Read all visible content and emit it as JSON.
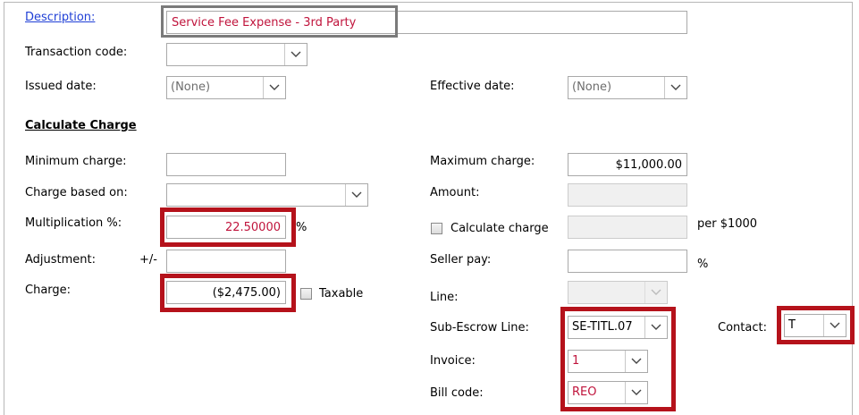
{
  "description": {
    "label": "Description:",
    "value": "Service Fee Expense - 3rd Party"
  },
  "transaction_code": {
    "label": "Transaction code:",
    "value": ""
  },
  "issued_date": {
    "label": "Issued date:",
    "value": "(None)"
  },
  "effective_date": {
    "label": "Effective date:",
    "value": "(None)"
  },
  "calculate_charge": {
    "heading": "Calculate Charge",
    "minimum_charge": {
      "label": "Minimum charge:",
      "value": ""
    },
    "maximum_charge": {
      "label": "Maximum charge:",
      "value": "$11,000.00"
    },
    "charge_based_on": {
      "label": "Charge based on:",
      "value": ""
    },
    "amount": {
      "label": "Amount:",
      "value": ""
    },
    "multiplication": {
      "label": "Multiplication %:",
      "value": "22.50000",
      "suffix": "%"
    },
    "calculate_checkbox": {
      "label": "Calculate charge",
      "checked": false
    },
    "per_1000": {
      "value": "",
      "suffix": "per $1000"
    },
    "adjustment": {
      "label": "Adjustment:",
      "sign": "+/-",
      "value": ""
    },
    "seller_pay": {
      "label": "Seller pay:",
      "value": "",
      "suffix": "%"
    },
    "charge": {
      "label": "Charge:",
      "value": "($2,475.00)"
    },
    "taxable": {
      "label": "Taxable",
      "checked": false
    },
    "line": {
      "label": "Line:",
      "value": ""
    },
    "sub_escrow_line": {
      "label": "Sub-Escrow Line:",
      "value": "SE-TITL.07"
    },
    "contact": {
      "label": "Contact:",
      "value": "T"
    },
    "invoice": {
      "label": "Invoice:",
      "value": "1"
    },
    "bill_code": {
      "label": "Bill code:",
      "value": "REO"
    }
  },
  "icons": {
    "dropdown": "chevron-down-icon"
  },
  "colors": {
    "highlight": "#b5121b",
    "value_red": "#c0143c",
    "link": "#1f3fd6"
  }
}
